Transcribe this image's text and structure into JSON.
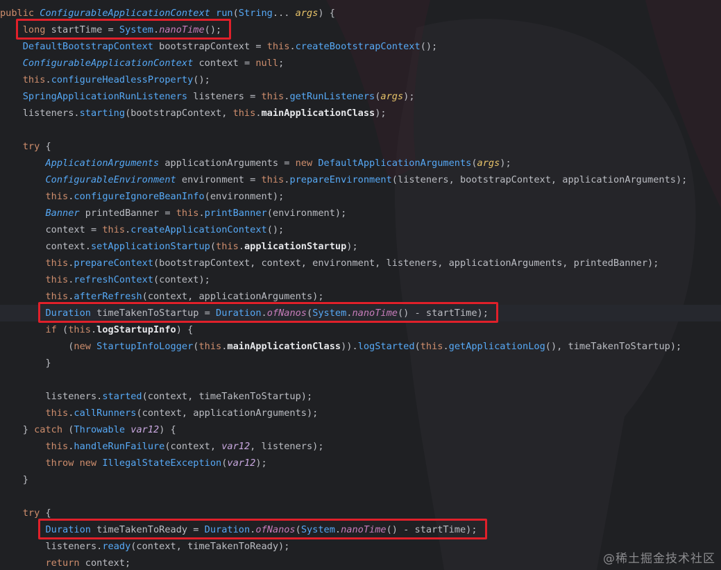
{
  "editor": {
    "lines": [
      [
        {
          "t": "public ",
          "c": "kw"
        },
        {
          "t": "ConfigurableApplicationContext",
          "c": "typei"
        },
        {
          "t": " ",
          "c": "plain"
        },
        {
          "t": "run",
          "c": "method"
        },
        {
          "t": "(",
          "c": "punct"
        },
        {
          "t": "String",
          "c": "type"
        },
        {
          "t": "... ",
          "c": "plain"
        },
        {
          "t": "args",
          "c": "param"
        },
        {
          "t": ") {",
          "c": "punct"
        }
      ],
      [
        {
          "t": "    long ",
          "c": "kw"
        },
        {
          "t": "startTime = ",
          "c": "plain"
        },
        {
          "t": "System",
          "c": "type"
        },
        {
          "t": ".",
          "c": "punct"
        },
        {
          "t": "nanoTime",
          "c": "static"
        },
        {
          "t": "();",
          "c": "punct"
        }
      ],
      [
        {
          "t": "    ",
          "c": "plain"
        },
        {
          "t": "DefaultBootstrapContext",
          "c": "type"
        },
        {
          "t": " bootstrapContext = ",
          "c": "plain"
        },
        {
          "t": "this",
          "c": "this"
        },
        {
          "t": ".",
          "c": "punct"
        },
        {
          "t": "createBootstrapContext",
          "c": "method"
        },
        {
          "t": "();",
          "c": "punct"
        }
      ],
      [
        {
          "t": "    ",
          "c": "plain"
        },
        {
          "t": "ConfigurableApplicationContext",
          "c": "typei"
        },
        {
          "t": " context = ",
          "c": "plain"
        },
        {
          "t": "null",
          "c": "null"
        },
        {
          "t": ";",
          "c": "punct"
        }
      ],
      [
        {
          "t": "    ",
          "c": "plain"
        },
        {
          "t": "this",
          "c": "this"
        },
        {
          "t": ".",
          "c": "punct"
        },
        {
          "t": "configureHeadlessProperty",
          "c": "method"
        },
        {
          "t": "();",
          "c": "punct"
        }
      ],
      [
        {
          "t": "    ",
          "c": "plain"
        },
        {
          "t": "SpringApplicationRunListeners",
          "c": "type"
        },
        {
          "t": " listeners = ",
          "c": "plain"
        },
        {
          "t": "this",
          "c": "this"
        },
        {
          "t": ".",
          "c": "punct"
        },
        {
          "t": "getRunListeners",
          "c": "method"
        },
        {
          "t": "(",
          "c": "punct"
        },
        {
          "t": "args",
          "c": "param"
        },
        {
          "t": ");",
          "c": "punct"
        }
      ],
      [
        {
          "t": "    listeners.",
          "c": "plain"
        },
        {
          "t": "starting",
          "c": "method"
        },
        {
          "t": "(bootstrapContext, ",
          "c": "plain"
        },
        {
          "t": "this",
          "c": "this"
        },
        {
          "t": ".",
          "c": "punct"
        },
        {
          "t": "mainApplicationClass",
          "c": "bold"
        },
        {
          "t": ");",
          "c": "punct"
        }
      ],
      [],
      [
        {
          "t": "    try ",
          "c": "kw"
        },
        {
          "t": "{",
          "c": "punct"
        }
      ],
      [
        {
          "t": "        ",
          "c": "plain"
        },
        {
          "t": "ApplicationArguments",
          "c": "typei"
        },
        {
          "t": " applicationArguments = ",
          "c": "plain"
        },
        {
          "t": "new ",
          "c": "kw"
        },
        {
          "t": "DefaultApplicationArguments",
          "c": "type"
        },
        {
          "t": "(",
          "c": "punct"
        },
        {
          "t": "args",
          "c": "param"
        },
        {
          "t": ");",
          "c": "punct"
        }
      ],
      [
        {
          "t": "        ",
          "c": "plain"
        },
        {
          "t": "ConfigurableEnvironment",
          "c": "typei"
        },
        {
          "t": " environment = ",
          "c": "plain"
        },
        {
          "t": "this",
          "c": "this"
        },
        {
          "t": ".",
          "c": "punct"
        },
        {
          "t": "prepareEnvironment",
          "c": "method"
        },
        {
          "t": "(listeners, bootstrapContext, applicationArguments);",
          "c": "plain"
        }
      ],
      [
        {
          "t": "        ",
          "c": "plain"
        },
        {
          "t": "this",
          "c": "this"
        },
        {
          "t": ".",
          "c": "punct"
        },
        {
          "t": "configureIgnoreBeanInfo",
          "c": "method"
        },
        {
          "t": "(environment);",
          "c": "plain"
        }
      ],
      [
        {
          "t": "        ",
          "c": "plain"
        },
        {
          "t": "Banner",
          "c": "typei"
        },
        {
          "t": " printedBanner = ",
          "c": "plain"
        },
        {
          "t": "this",
          "c": "this"
        },
        {
          "t": ".",
          "c": "punct"
        },
        {
          "t": "printBanner",
          "c": "method"
        },
        {
          "t": "(environment);",
          "c": "plain"
        }
      ],
      [
        {
          "t": "        context = ",
          "c": "plain"
        },
        {
          "t": "this",
          "c": "this"
        },
        {
          "t": ".",
          "c": "punct"
        },
        {
          "t": "createApplicationContext",
          "c": "method"
        },
        {
          "t": "();",
          "c": "punct"
        }
      ],
      [
        {
          "t": "        context.",
          "c": "plain"
        },
        {
          "t": "setApplicationStartup",
          "c": "method"
        },
        {
          "t": "(",
          "c": "punct"
        },
        {
          "t": "this",
          "c": "this"
        },
        {
          "t": ".",
          "c": "punct"
        },
        {
          "t": "applicationStartup",
          "c": "bold"
        },
        {
          "t": ");",
          "c": "punct"
        }
      ],
      [
        {
          "t": "        ",
          "c": "plain"
        },
        {
          "t": "this",
          "c": "this"
        },
        {
          "t": ".",
          "c": "punct"
        },
        {
          "t": "prepareContext",
          "c": "method"
        },
        {
          "t": "(bootstrapContext, context, environment, listeners, applicationArguments, printedBanner);",
          "c": "plain"
        }
      ],
      [
        {
          "t": "        ",
          "c": "plain"
        },
        {
          "t": "this",
          "c": "this"
        },
        {
          "t": ".",
          "c": "punct"
        },
        {
          "t": "refreshContext",
          "c": "method"
        },
        {
          "t": "(context);",
          "c": "plain"
        }
      ],
      [
        {
          "t": "        ",
          "c": "plain"
        },
        {
          "t": "this",
          "c": "this"
        },
        {
          "t": ".",
          "c": "punct"
        },
        {
          "t": "afterRefresh",
          "c": "method"
        },
        {
          "t": "(context, applicationArguments);",
          "c": "plain"
        }
      ],
      [
        {
          "t": "        ",
          "c": "plain"
        },
        {
          "t": "Duration",
          "c": "type"
        },
        {
          "t": " timeTakenToStartup = ",
          "c": "plain"
        },
        {
          "t": "Duration",
          "c": "type"
        },
        {
          "t": ".",
          "c": "punct"
        },
        {
          "t": "ofNanos",
          "c": "static"
        },
        {
          "t": "(",
          "c": "punct"
        },
        {
          "t": "System",
          "c": "type"
        },
        {
          "t": ".",
          "c": "punct"
        },
        {
          "t": "nanoTime",
          "c": "static"
        },
        {
          "t": "() - startTime);",
          "c": "plain"
        }
      ],
      [
        {
          "t": "        if ",
          "c": "kw"
        },
        {
          "t": "(",
          "c": "punct"
        },
        {
          "t": "this",
          "c": "this"
        },
        {
          "t": ".",
          "c": "punct"
        },
        {
          "t": "logStartupInfo",
          "c": "bold"
        },
        {
          "t": ") {",
          "c": "punct"
        }
      ],
      [
        {
          "t": "            (",
          "c": "plain"
        },
        {
          "t": "new ",
          "c": "kw"
        },
        {
          "t": "StartupInfoLogger",
          "c": "type"
        },
        {
          "t": "(",
          "c": "punct"
        },
        {
          "t": "this",
          "c": "this"
        },
        {
          "t": ".",
          "c": "punct"
        },
        {
          "t": "mainApplicationClass",
          "c": "bold"
        },
        {
          "t": ")).",
          "c": "punct"
        },
        {
          "t": "logStarted",
          "c": "method"
        },
        {
          "t": "(",
          "c": "punct"
        },
        {
          "t": "this",
          "c": "this"
        },
        {
          "t": ".",
          "c": "punct"
        },
        {
          "t": "getApplicationLog",
          "c": "method"
        },
        {
          "t": "(), timeTakenToStartup);",
          "c": "plain"
        }
      ],
      [
        {
          "t": "        }",
          "c": "punct"
        }
      ],
      [],
      [
        {
          "t": "        listeners.",
          "c": "plain"
        },
        {
          "t": "started",
          "c": "method"
        },
        {
          "t": "(context, timeTakenToStartup);",
          "c": "plain"
        }
      ],
      [
        {
          "t": "        ",
          "c": "plain"
        },
        {
          "t": "this",
          "c": "this"
        },
        {
          "t": ".",
          "c": "punct"
        },
        {
          "t": "callRunners",
          "c": "method"
        },
        {
          "t": "(context, applicationArguments);",
          "c": "plain"
        }
      ],
      [
        {
          "t": "    } ",
          "c": "punct"
        },
        {
          "t": "catch ",
          "c": "kw"
        },
        {
          "t": "(",
          "c": "punct"
        },
        {
          "t": "Throwable",
          "c": "type"
        },
        {
          "t": " ",
          "c": "plain"
        },
        {
          "t": "var12",
          "c": "var"
        },
        {
          "t": ") {",
          "c": "punct"
        }
      ],
      [
        {
          "t": "        ",
          "c": "plain"
        },
        {
          "t": "this",
          "c": "this"
        },
        {
          "t": ".",
          "c": "punct"
        },
        {
          "t": "handleRunFailure",
          "c": "method"
        },
        {
          "t": "(context, ",
          "c": "plain"
        },
        {
          "t": "var12",
          "c": "var"
        },
        {
          "t": ", listeners);",
          "c": "plain"
        }
      ],
      [
        {
          "t": "        throw new ",
          "c": "kw"
        },
        {
          "t": "IllegalStateException",
          "c": "type"
        },
        {
          "t": "(",
          "c": "punct"
        },
        {
          "t": "var12",
          "c": "var"
        },
        {
          "t": ");",
          "c": "punct"
        }
      ],
      [
        {
          "t": "    }",
          "c": "punct"
        }
      ],
      [],
      [
        {
          "t": "    try ",
          "c": "kw"
        },
        {
          "t": "{",
          "c": "punct"
        }
      ],
      [
        {
          "t": "        ",
          "c": "plain"
        },
        {
          "t": "Duration",
          "c": "type"
        },
        {
          "t": " timeTakenToReady = ",
          "c": "plain"
        },
        {
          "t": "Duration",
          "c": "type"
        },
        {
          "t": ".",
          "c": "punct"
        },
        {
          "t": "ofNanos",
          "c": "static"
        },
        {
          "t": "(",
          "c": "punct"
        },
        {
          "t": "System",
          "c": "type"
        },
        {
          "t": ".",
          "c": "punct"
        },
        {
          "t": "nanoTime",
          "c": "static"
        },
        {
          "t": "() - startTime);",
          "c": "plain"
        }
      ],
      [
        {
          "t": "        listeners.",
          "c": "plain"
        },
        {
          "t": "ready",
          "c": "method"
        },
        {
          "t": "(context, timeTakenToReady);",
          "c": "plain"
        }
      ],
      [
        {
          "t": "        return ",
          "c": "kw"
        },
        {
          "t": "context;",
          "c": "plain"
        }
      ]
    ],
    "current_line": 18,
    "highlighted_lines": [
      1,
      18,
      31
    ]
  },
  "watermark": "@稀土掘金技术社区",
  "colors": {
    "background": "#1f2023",
    "highlight_border": "#e0202a"
  }
}
